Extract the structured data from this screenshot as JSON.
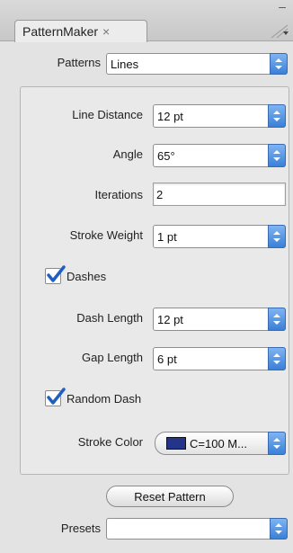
{
  "panel": {
    "tab_title": "PatternMaker",
    "tab_close": "×",
    "menu_glyph": "–"
  },
  "patterns": {
    "label": "Patterns",
    "value": "Lines"
  },
  "settings": {
    "line_distance": {
      "label": "Line Distance",
      "value": "12 pt"
    },
    "angle": {
      "label": "Angle",
      "value": "65°"
    },
    "iterations": {
      "label": "Iterations",
      "value": "2"
    },
    "stroke_weight": {
      "label": "Stroke Weight",
      "value": "1 pt"
    },
    "dashes": {
      "label": "Dashes",
      "checked": true
    },
    "dash_length": {
      "label": "Dash Length",
      "value": "12 pt"
    },
    "gap_length": {
      "label": "Gap Length",
      "value": "6 pt"
    },
    "random_dash": {
      "label": "Random Dash",
      "checked": true
    },
    "stroke_color": {
      "label": "Stroke Color",
      "value": "C=100 M...",
      "swatch": "#22358a"
    }
  },
  "reset_button": {
    "label": "Reset Pattern"
  },
  "presets": {
    "label": "Presets",
    "value": ""
  },
  "colors": {
    "accent": "#3a80d8",
    "check": "#1f5fc2"
  }
}
